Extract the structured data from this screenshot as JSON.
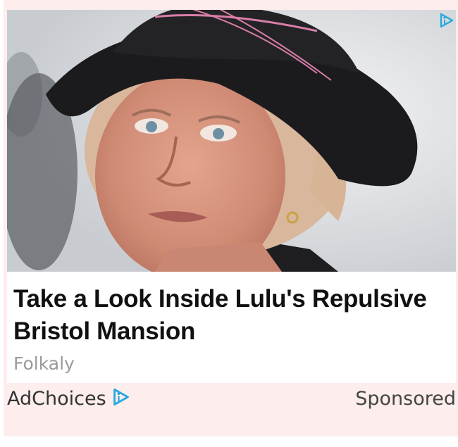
{
  "ad": {
    "headline": "Take a Look Inside Lulu's Repulsive Bristol Mansion",
    "source": "Folkaly",
    "adchoices_label": "AdChoices",
    "sponsored_label": "Sponsored",
    "image": {
      "subject": "woman-in-black-hat",
      "icon": "portrait-photo"
    }
  },
  "icons": {
    "adchoices_corner": "adchoices-icon",
    "adchoices_footer": "adchoices-icon"
  },
  "colors": {
    "frame_background": "#fdeeed",
    "headline": "#111111",
    "source": "#9a9a9a",
    "adchoices_blue": "#29a8e0"
  }
}
